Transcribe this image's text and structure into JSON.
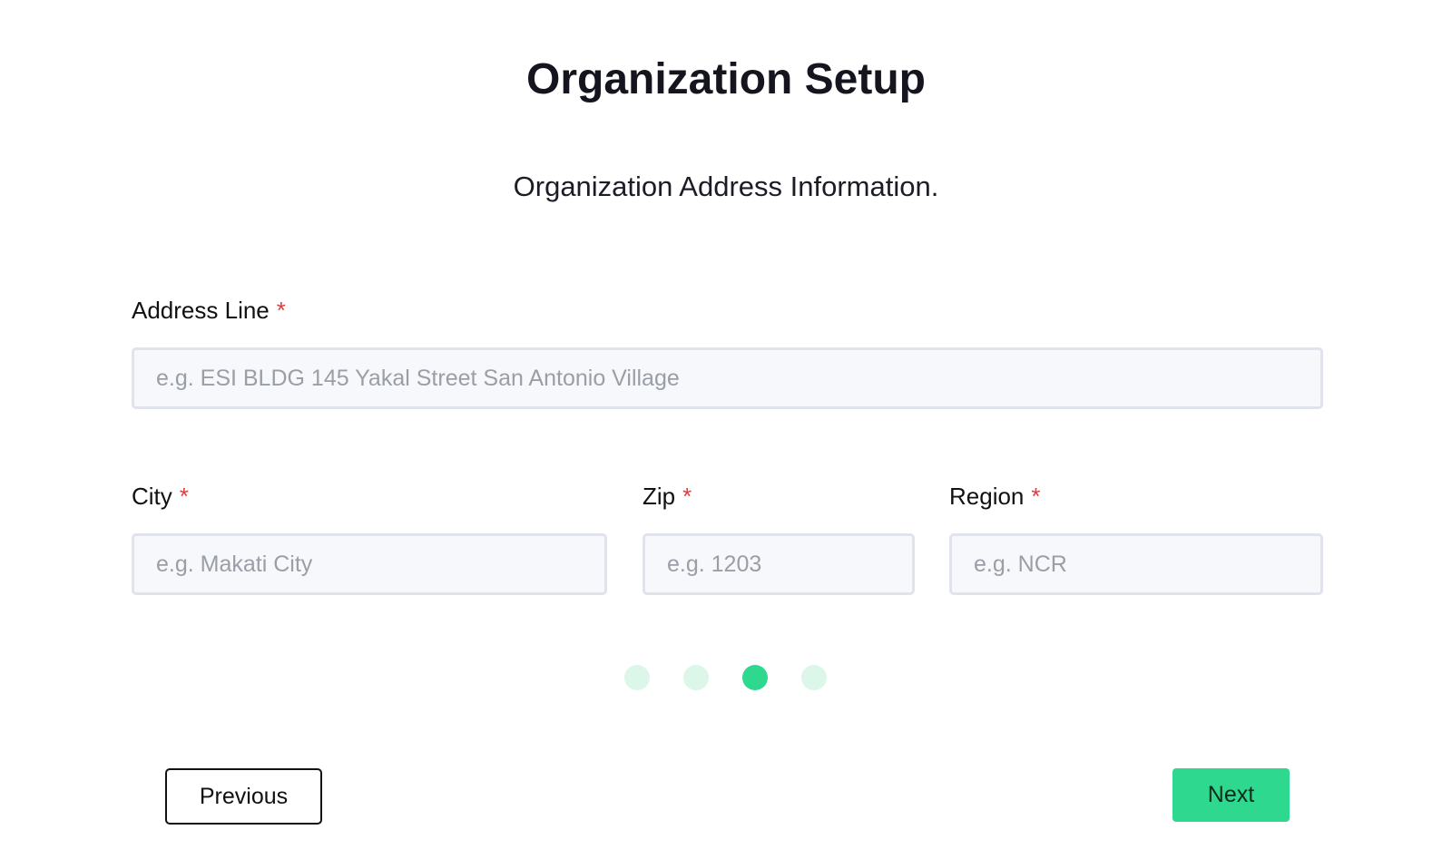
{
  "header": {
    "title": "Organization Setup",
    "subtitle": "Organization Address Information."
  },
  "form": {
    "required_marker": "*",
    "address_line": {
      "label": "Address Line",
      "placeholder": "e.g. ESI BLDG 145 Yakal Street San Antonio Village",
      "value": ""
    },
    "city": {
      "label": "City",
      "placeholder": "e.g. Makati City",
      "value": ""
    },
    "zip": {
      "label": "Zip",
      "placeholder": "e.g. 1203",
      "value": ""
    },
    "region": {
      "label": "Region",
      "placeholder": "e.g. NCR",
      "value": ""
    }
  },
  "stepper": {
    "total_steps": 4,
    "current_step": 3
  },
  "footer": {
    "previous_label": "Previous",
    "next_label": "Next"
  },
  "colors": {
    "accent": "#2ed88e",
    "accent_light": "#dcf6ea",
    "required": "#e23b3b",
    "input_background": "#f7f8fc",
    "input_border": "#e0e3ec"
  }
}
